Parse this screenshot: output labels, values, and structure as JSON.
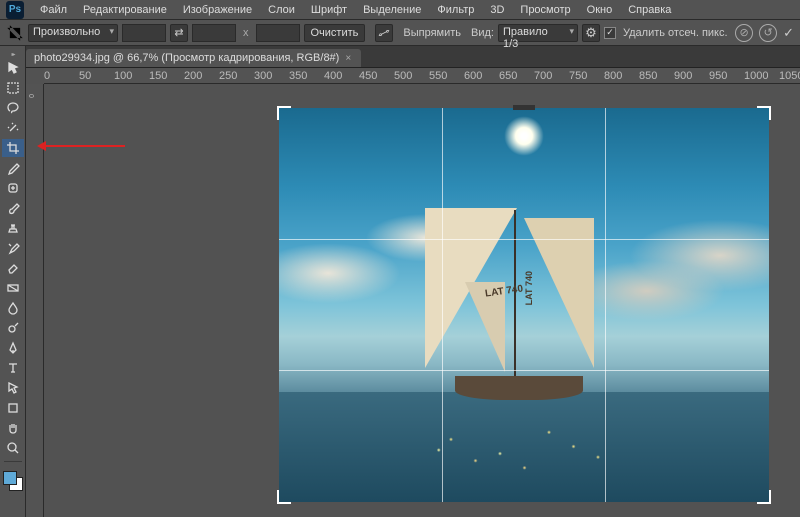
{
  "menu": [
    "Файл",
    "Редактирование",
    "Изображение",
    "Слои",
    "Шрифт",
    "Выделение",
    "Фильтр",
    "3D",
    "Просмотр",
    "Окно",
    "Справка"
  ],
  "opt": {
    "ratio_label": "Произвольно",
    "w": "",
    "h": "",
    "clear": "Очистить",
    "straighten": "Выпрямить",
    "view_label": "Вид:",
    "view_value": "Правило 1/3",
    "delete_px": "Удалить отсеч. пикс."
  },
  "tab": {
    "title": "photo29934.jpg @ 66,7% (Просмотр кадрирования, RGB/8#)"
  },
  "ruler_h": [
    "0",
    "50",
    "100",
    "150",
    "200",
    "250",
    "300",
    "350",
    "400",
    "450",
    "500",
    "550",
    "600",
    "650",
    "700",
    "750",
    "800",
    "850",
    "900",
    "950",
    "1000",
    "1050"
  ],
  "sail": {
    "a": "LAT\n740",
    "b": "LAT 740"
  },
  "tools": [
    "move",
    "marquee",
    "lasso",
    "wand",
    "crop",
    "eyedrop",
    "heal",
    "brush",
    "stamp",
    "history",
    "eraser",
    "gradient",
    "blur",
    "dodge",
    "pen",
    "type",
    "path",
    "shape",
    "hand",
    "zoom"
  ]
}
